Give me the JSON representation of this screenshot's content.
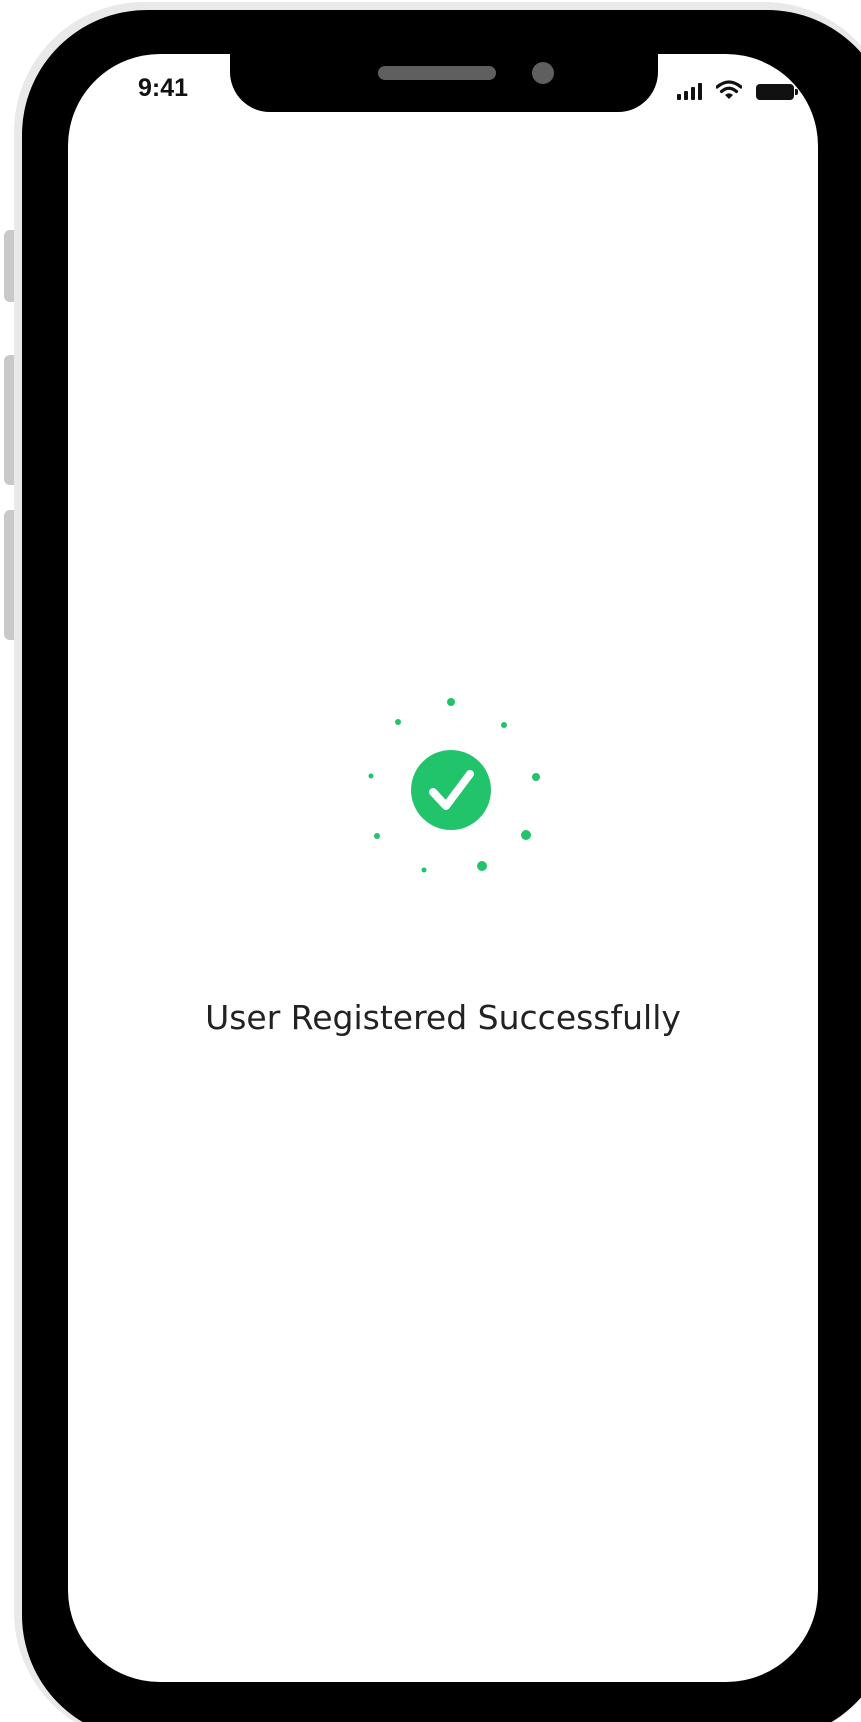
{
  "status_bar": {
    "time": "9:41",
    "signal_icon": "signal-bars-icon",
    "wifi_icon": "wifi-icon",
    "battery_icon": "battery-icon"
  },
  "success": {
    "icon": "check-circle-icon",
    "accent_color": "#21C46B",
    "message": "User Registered Successfully"
  }
}
